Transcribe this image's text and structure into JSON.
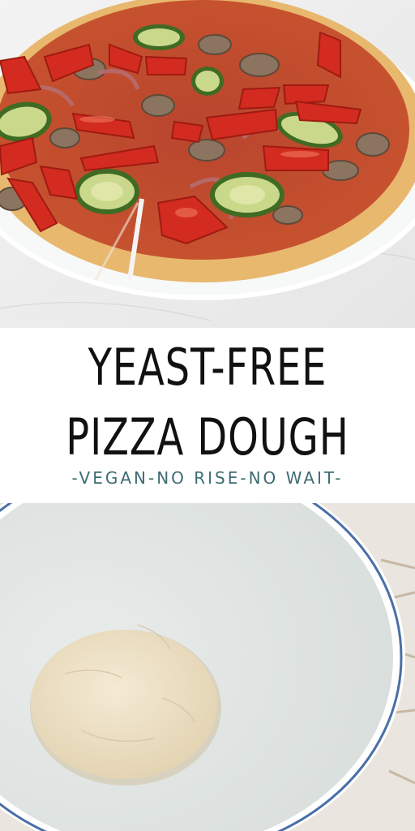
{
  "title_line_1": "YEAST-FREE",
  "title_line_2": "PIZZA DOUGH",
  "subtitle": "-VEGAN-NO RISE-NO WAIT-",
  "colors": {
    "title": "#111111",
    "subtitle": "#3d6b73",
    "band_background": "#ffffff",
    "crust": "#e9b872",
    "sauce": "#c9452f",
    "pepper": "#d42a1e",
    "zucchini": "#5e8f2c",
    "dough": "#eee2c7",
    "bowl": "#dfe5e3"
  }
}
